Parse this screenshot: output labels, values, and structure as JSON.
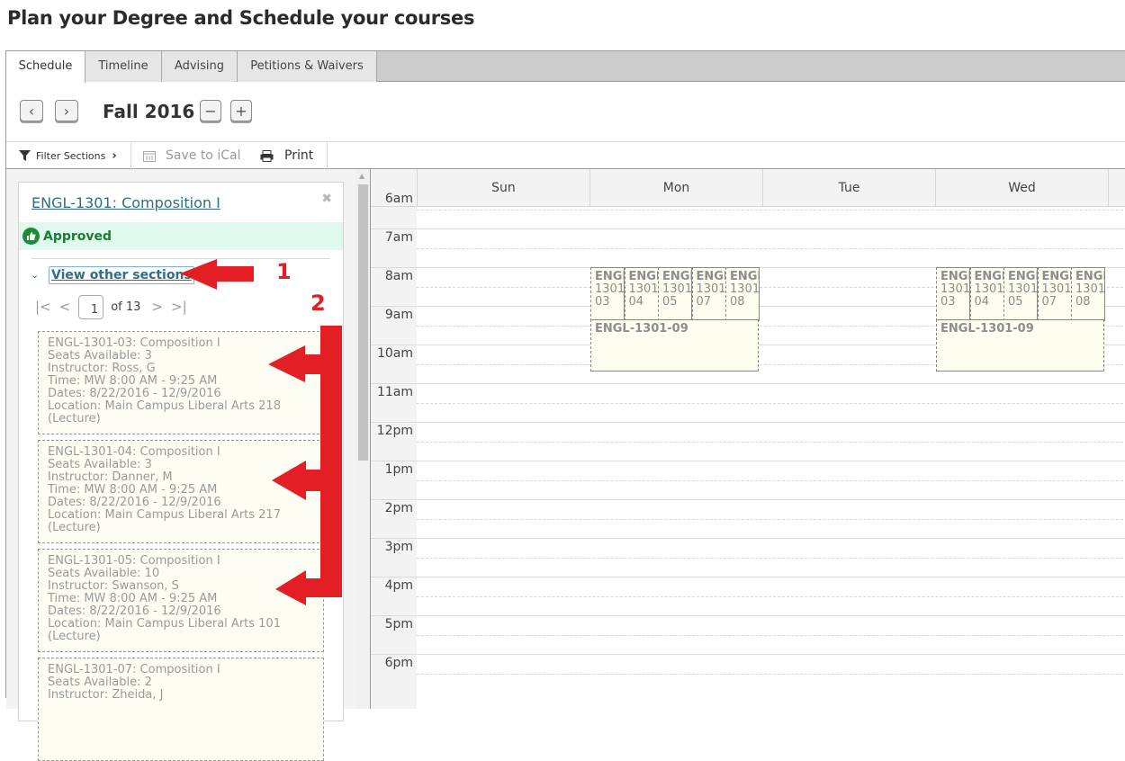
{
  "page": {
    "title": "Plan your Degree and Schedule your courses"
  },
  "tabs": [
    {
      "label": "Schedule",
      "active": true
    },
    {
      "label": "Timeline",
      "active": false
    },
    {
      "label": "Advising",
      "active": false
    },
    {
      "label": "Petitions & Waivers",
      "active": false
    }
  ],
  "term": {
    "label": "Fall 2016",
    "prev_icon": "chevron-left-icon",
    "next_icon": "chevron-right-icon",
    "remove_icon": "minus-icon",
    "add_icon": "plus-icon"
  },
  "toolbar": {
    "filter_label": "Filter Sections",
    "save_ical_label": "Save to iCal",
    "print_label": "Print"
  },
  "course": {
    "title": "ENGL-1301: Composition I",
    "status": "Approved",
    "status_color": "#1d7a36",
    "view_other_label": "View other sections",
    "pager": {
      "current": "1",
      "of_label": "of 13"
    }
  },
  "sections": [
    {
      "title": "ENGL-1301-03: Composition I",
      "seats": "Seats Available: 3",
      "instructor": "Instructor: Ross, G",
      "time": "Time: MW 8:00 AM - 9:25 AM",
      "dates": "Dates: 8/22/2016 - 12/9/2016",
      "location": "Location: Main Campus Liberal Arts 218",
      "type": "(Lecture)"
    },
    {
      "title": "ENGL-1301-04: Composition I",
      "seats": "Seats Available: 3",
      "instructor": "Instructor: Danner, M",
      "time": "Time: MW 8:00 AM - 9:25 AM",
      "dates": "Dates: 8/22/2016 - 12/9/2016",
      "location": "Location: Main Campus Liberal Arts 217",
      "type": "(Lecture)"
    },
    {
      "title": "ENGL-1301-05: Composition I",
      "seats": "Seats Available: 10",
      "instructor": "Instructor: Swanson, S",
      "time": "Time: MW 8:00 AM - 9:25 AM",
      "dates": "Dates: 8/22/2016 - 12/9/2016",
      "location": "Location: Main Campus Liberal Arts 101",
      "type": "(Lecture)"
    },
    {
      "title": "ENGL-1301-07: Composition I",
      "seats": "Seats Available: 2",
      "instructor": "Instructor: Zheida, J",
      "time": "",
      "dates": "",
      "location": "",
      "type": ""
    }
  ],
  "calendar": {
    "days": [
      "Sun",
      "Mon",
      "Tue",
      "Wed"
    ],
    "hours": [
      "6am",
      "7am",
      "8am",
      "9am",
      "10am",
      "11am",
      "12pm",
      "1pm",
      "2pm",
      "3pm",
      "4pm",
      "5pm",
      "6pm"
    ],
    "events_short": [
      {
        "line1": "ENGL",
        "line2": "1301",
        "line3": "03"
      },
      {
        "line1": "ENGL",
        "line2": "1301",
        "line3": "04"
      },
      {
        "line1": "ENGL",
        "line2": "1301",
        "line3": "05"
      },
      {
        "line1": "ENGL",
        "line2": "1301",
        "line3": "07"
      },
      {
        "line1": "ENGL",
        "line2": "1301",
        "line3": "08"
      }
    ],
    "event_wide": "ENGL-1301-09",
    "event_days": [
      "Mon",
      "Wed"
    ]
  },
  "annotations": {
    "label1": "1",
    "label2": "2",
    "color": "#e31e24"
  }
}
